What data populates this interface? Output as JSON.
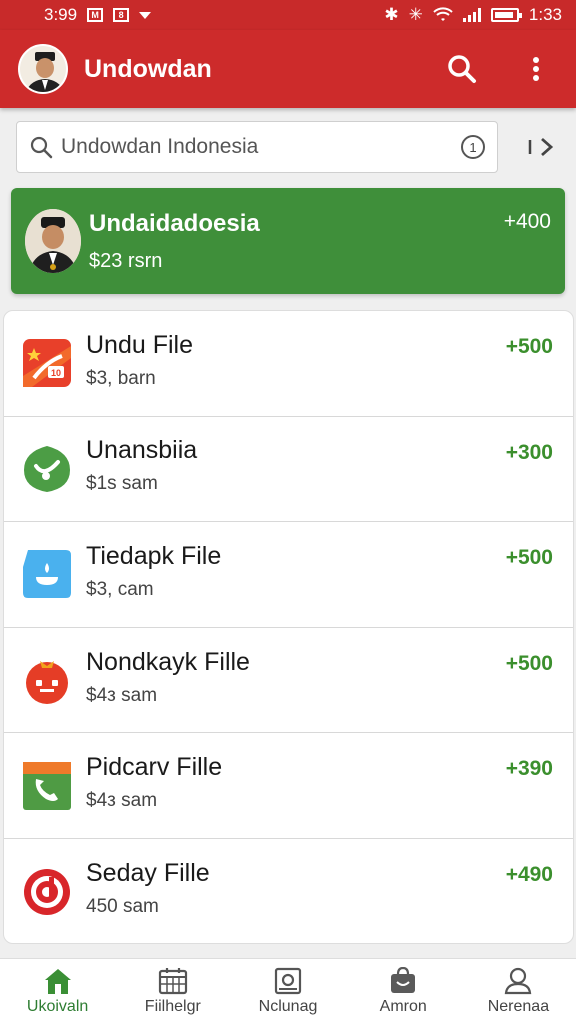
{
  "status_bar": {
    "time_left": "3:99",
    "time_right": "1:33",
    "box_label": "M"
  },
  "app": {
    "title": "Undowdan"
  },
  "search": {
    "value": "Undowdan Indonesia",
    "info_label": "1"
  },
  "featured": {
    "title": "Undaidadoesia",
    "subtitle": "$23 rsrn",
    "amount": "+400"
  },
  "items": [
    {
      "title": "Undu File",
      "subtitle": "$3, barn",
      "amount": "+500",
      "icon": "red-app-icon"
    },
    {
      "title": "Unansbiia",
      "subtitle": "$1s sam",
      "amount": "+300",
      "icon": "green-leaf-icon"
    },
    {
      "title": "Tiedapk File",
      "subtitle": "$3, cam",
      "amount": "+500",
      "icon": "blue-app-icon"
    },
    {
      "title": "Nondkayk Fille",
      "subtitle": "$4з sam",
      "amount": "+500",
      "icon": "tomato-icon"
    },
    {
      "title": "Pidcarv Fille",
      "subtitle": "$4з sam",
      "amount": "+390",
      "icon": "phone-app-icon"
    },
    {
      "title": "Seday Fille",
      "subtitle": "450 sam",
      "amount": "+490",
      "icon": "red-circle-icon"
    }
  ],
  "nav": [
    {
      "label": "Ukoivaln",
      "icon": "home-icon",
      "active": true
    },
    {
      "label": "Fiilhelgr",
      "icon": "calendar-icon"
    },
    {
      "label": "Nclunag",
      "icon": "photo-icon"
    },
    {
      "label": "Amron",
      "icon": "bag-icon"
    },
    {
      "label": "Nerenaa",
      "icon": "person-icon"
    }
  ],
  "colors": {
    "primary": "#cd2b2b",
    "accent_green": "#3f8f3a",
    "amount_green": "#3b8f2d"
  }
}
